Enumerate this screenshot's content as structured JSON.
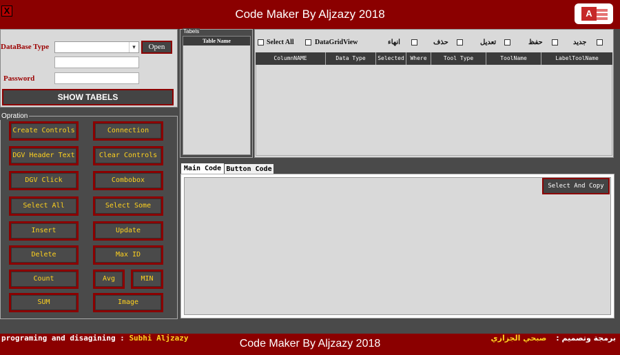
{
  "window": {
    "title": "Code Maker By Aljzazy 2018",
    "close_label": "X",
    "logo_letter": "A",
    "logo_icon": "ms-access-icon"
  },
  "connection": {
    "db_type_label": "DataBase Type",
    "db_type_value": "",
    "open_label": "Open",
    "password_label": "Password",
    "show_tables_label": "SHOW TABELS"
  },
  "operation": {
    "title": "Opration",
    "buttons": {
      "create_controls": "Create Controls",
      "connection": "Connection",
      "dgv_header_text": "DGV Header Text",
      "clear_controls": "Clear Controls",
      "dgv_click": "DGV Click",
      "combobox": "Combobox",
      "select_all": "Select All",
      "select_some": "Select Some",
      "insert": "Insert",
      "update": "Update",
      "delete": "Delete",
      "max_id": "Max ID",
      "count": "Count",
      "avg": "Avg",
      "min": "MIN",
      "sum": "SUM",
      "image": "Image"
    }
  },
  "tabels": {
    "title": "Tabels",
    "header": "Table Name"
  },
  "columns": {
    "checks": {
      "select_all": "Select All",
      "datagridview": "DataGridView",
      "finish": "انهاء",
      "delete": "حذف",
      "edit": "تعديل",
      "save": "حفظ",
      "new": "جديد"
    },
    "headers": [
      "ColumnNAME",
      "Data Type",
      "Selected",
      "Where",
      "Tool Type",
      "ToolName",
      "LabelToolName"
    ]
  },
  "code": {
    "tabs": [
      "Main Code",
      "Button Code"
    ],
    "copy_label": "Select And Copy"
  },
  "footer": {
    "credit_label": "programing and disagining :",
    "credit_name": "Subhi Aljzazy",
    "title": "Code Maker By Aljzazy 2018",
    "arabic_label": "برمجة وتصميم :",
    "arabic_name": "صبحي الجزازي"
  },
  "colors": {
    "accent": "#8b0000",
    "button_text": "#ffd21f",
    "background": "#4a4a4a",
    "panel": "#d9d9d9"
  }
}
